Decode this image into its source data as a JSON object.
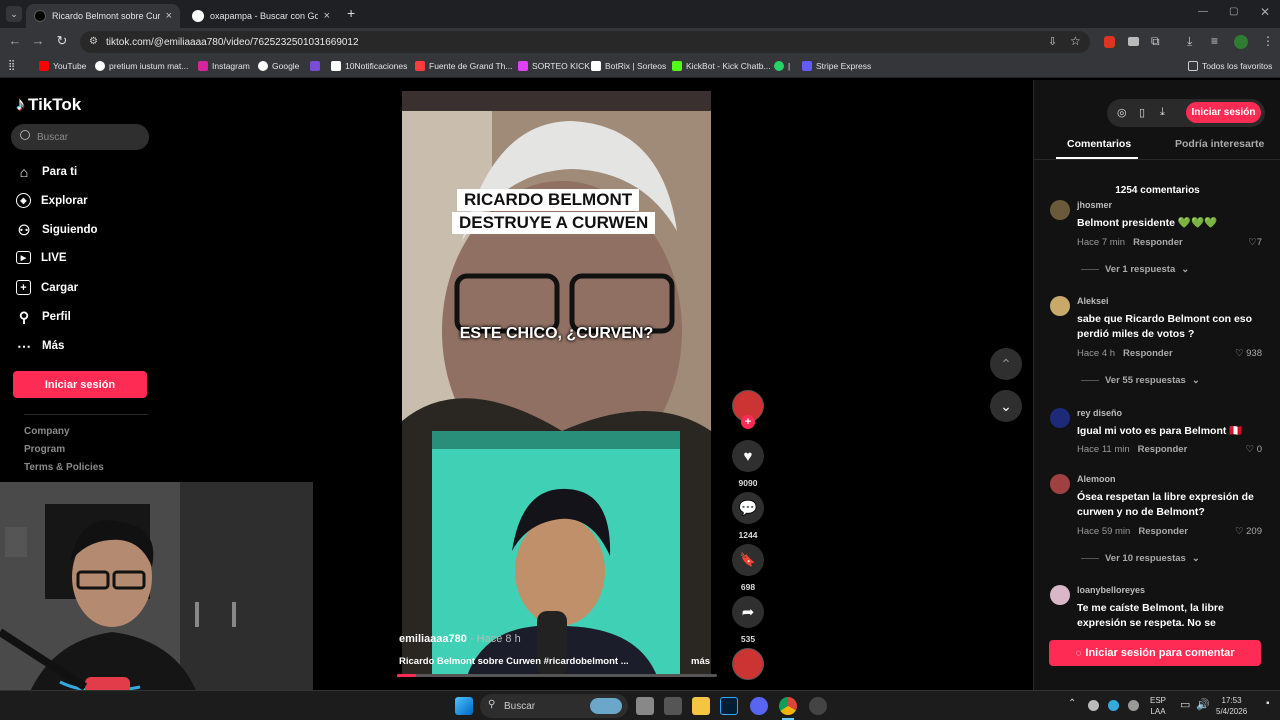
{
  "browser": {
    "tabs": [
      {
        "title": "Ricardo Belmont sobre Curwen",
        "active": true
      },
      {
        "title": "oxapampa - Buscar con Google",
        "active": false
      }
    ],
    "new_tab_symbol": "+",
    "url": "tiktok.com/@emiliaaaa780/video/7625232501031669012",
    "bookmarks": [
      {
        "label": "YouTube",
        "color": "#ff0000"
      },
      {
        "label": "pretium iustum mat...",
        "color": "#ffffff"
      },
      {
        "label": "Instagram",
        "color": "#d6249f"
      },
      {
        "label": "Google",
        "color": "#4285f4"
      },
      {
        "label": "",
        "color": "#7a4bd6"
      },
      {
        "label": "10Notificaciones",
        "color": "#ffffff"
      },
      {
        "label": "Fuente de Grand Th...",
        "color": "#ff3b3b"
      },
      {
        "label": "SORTEO KICK",
        "color": "#e040fb"
      },
      {
        "label": "BotRix | Sorteos",
        "color": "#ffffff"
      },
      {
        "label": "KickBot - Kick Chatb...",
        "color": "#53fc18"
      },
      {
        "label": "|",
        "color": "#25d366"
      },
      {
        "label": "Stripe Express",
        "color": "#635bff"
      }
    ],
    "all_bookmarks": "Todos los favoritos"
  },
  "sidebar": {
    "logo": "TikTok",
    "search_placeholder": "Buscar",
    "nav": [
      {
        "label": "Para ti",
        "icon": "home-icon"
      },
      {
        "label": "Explorar",
        "icon": "compass-icon"
      },
      {
        "label": "Siguiendo",
        "icon": "following-icon"
      },
      {
        "label": "LIVE",
        "icon": "live-icon"
      },
      {
        "label": "Cargar",
        "icon": "upload-icon"
      },
      {
        "label": "Perfil",
        "icon": "profile-icon"
      },
      {
        "label": "Más",
        "icon": "more-icon"
      }
    ],
    "login": "Iniciar sesión",
    "footer": [
      "Company",
      "Program",
      "Terms & Policies"
    ]
  },
  "video": {
    "title_line1": "RICARDO BELMONT",
    "title_line2": "DESTRUYE A CURWEN",
    "subtitle": "ESTE CHICO, ¿CURVEN?",
    "author": "emiliaaaa780",
    "time_ago": "· Hace 8 h",
    "description": "Ricardo Belmont sobre Curwen #ricardobelmont ...",
    "more": "más",
    "progress": 0.06
  },
  "actions": {
    "likes": "9090",
    "comments": "1244",
    "saves": "698",
    "shares": "535",
    "follow_symbol": "+"
  },
  "panel": {
    "login": "Iniciar sesión",
    "tabs": [
      "Comentarios",
      "Podría interesarte"
    ],
    "comment_count": "1254 comentarios",
    "comments": [
      {
        "user": "jhosmer",
        "text": "Belmont presidente 💚💚💚",
        "time": "Hace 7 min",
        "reply": "Responder",
        "likes": "7",
        "more": "Ver 1 respuesta",
        "avatar": "#6b5a3a"
      },
      {
        "user": "Aleksei",
        "text": "sabe que Ricardo Belmont con eso perdió miles de votos ?",
        "time": "Hace 4 h",
        "reply": "Responder",
        "likes": "938",
        "more": "Ver 55 respuestas",
        "avatar": "#c9a96a"
      },
      {
        "user": "rey diseño",
        "text": "Igual mi voto es para Belmont 🇵🇪",
        "time": "Hace 11 min",
        "reply": "Responder",
        "likes": "0",
        "more": "",
        "avatar": "#1d2a7a"
      },
      {
        "user": "Alemoon",
        "text": "Ósea respetan la libre expresión de curwen y no de Belmont?",
        "time": "Hace 59 min",
        "reply": "Responder",
        "likes": "209",
        "more": "Ver 10 respuestas",
        "avatar": "#a04040"
      },
      {
        "user": "loanybelloreyes",
        "text": "Te me caíste Belmont, la libre expresión se respeta. No se",
        "time": "",
        "reply": "",
        "likes": "",
        "more": "",
        "avatar": "#d9b7c9"
      }
    ],
    "comment_login": "Iniciar sesión para comentar"
  },
  "taskbar": {
    "search": "Buscar",
    "lang_line1": "ESP",
    "lang_line2": "LAA",
    "time": "17:53",
    "date": "5/4/2026"
  }
}
